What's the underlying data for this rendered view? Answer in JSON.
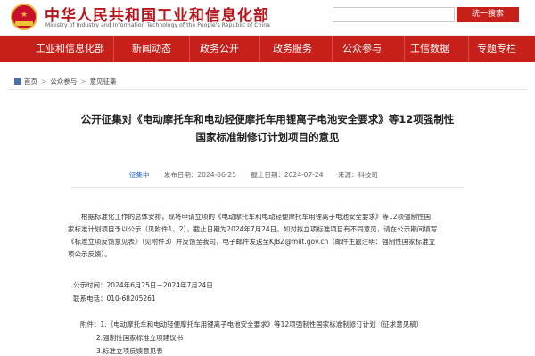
{
  "header": {
    "site_title": "中华人民共和国工业和信息化部",
    "site_subtitle": "Ministry of Industry and Information Technology of the People's Republic of China",
    "search_placeholder": "",
    "search_button": "统一搜索",
    "emblem_glyph": "★"
  },
  "nav": {
    "items": [
      "工业和信息化部",
      "新闻动态",
      "政务公开",
      "政务服务",
      "公众参与",
      "工信数据",
      "专题专栏"
    ]
  },
  "breadcrumb": {
    "home": "首页",
    "level1": "公众参与",
    "level2": "意见征集",
    "separator": ">"
  },
  "article": {
    "title_line1": "公开征集对《电动摩托车和电动轻便摩托车用锂离子电池安全要求》等12项强制性",
    "title_line2": "国家标准制修订计划项目的意见",
    "meta": {
      "category": "征集中",
      "start_date": "发布日期：2024-06-25",
      "end_date": "截止日期：2024-07-24",
      "source": "来源：科技司"
    },
    "body_lines": [
      "根据标准化工作的总体安排，现将申请立项的《电动摩托车和电动轻便摩托车用锂离子电池安全要求》等12项强制性国",
      "家标准计划项目予以公示（见附件1、2），截止日期为2024年7月24日。如对拟立项标准项目有不同意见，请在公示期间填写",
      "《标准立项反馈意见表》（见附件3）并反馈至我司，电子邮件发送至KJBZ@miit.gov.cn（邮件主题注明：强制性国家标准立",
      "项公示反馈）。"
    ],
    "period": "公示时间：2024年6月25日－2024年7月24日",
    "phone": "联系电话：010-68205261",
    "attachments": [
      "附件：1.《电动摩托车和电动轻便摩托车用锂离子电池安全要求》等12项强制性国家标准制修订计划（征求意见稿）",
      "2.强制性国家标准立项建议书",
      "3.标准立项反馈意见表"
    ]
  }
}
